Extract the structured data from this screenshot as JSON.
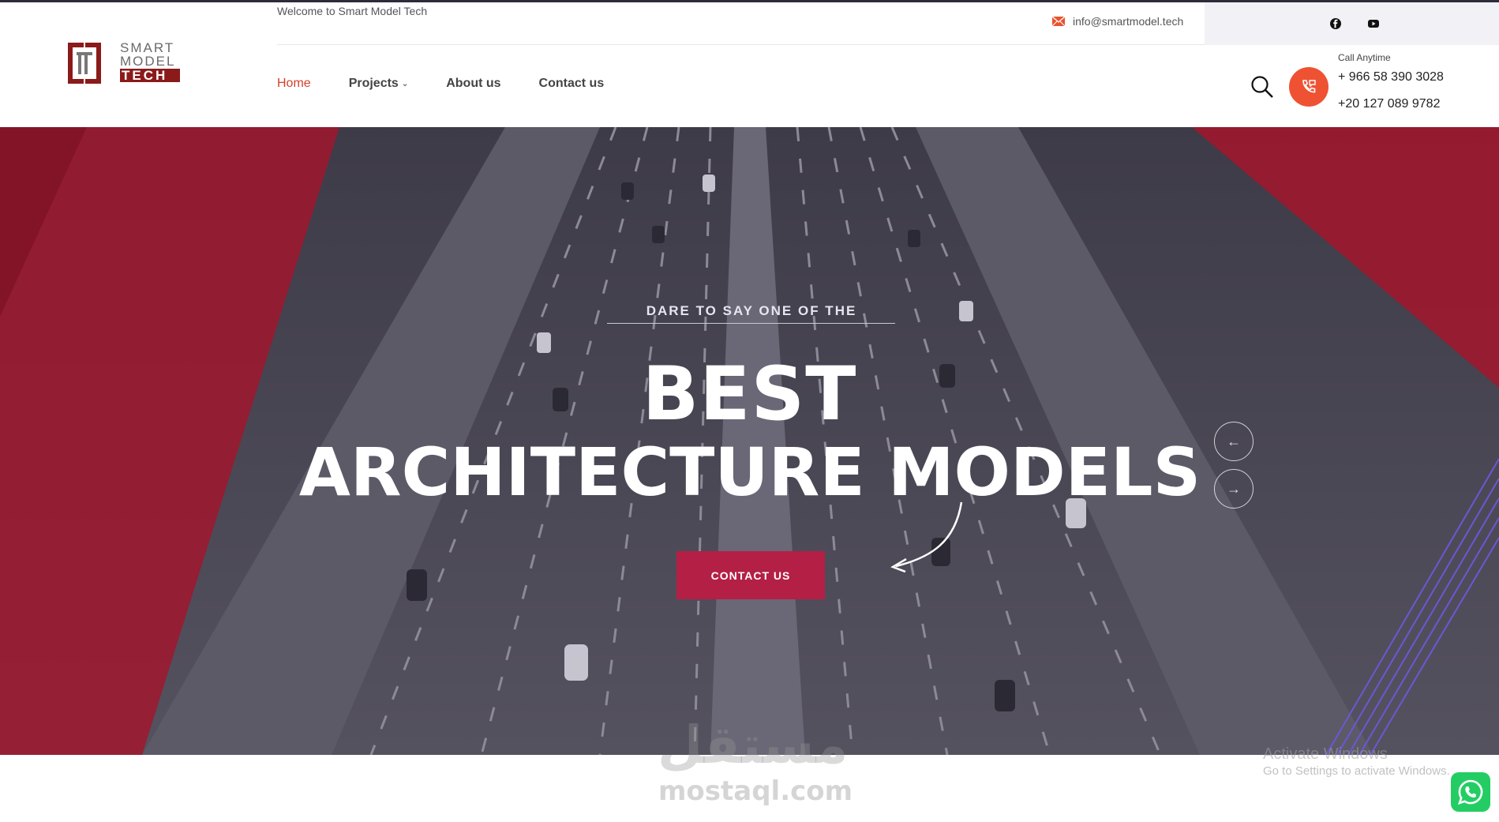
{
  "topbar": {
    "welcome": "Welcome to Smart Model Tech",
    "email": "info@smartmodel.tech",
    "social": [
      "facebook-icon",
      "youtube-icon"
    ]
  },
  "logo": {
    "line1": "SMART",
    "line2": "MODEL",
    "line3": "TECH"
  },
  "nav": {
    "items": [
      {
        "label": "Home",
        "active": true
      },
      {
        "label": "Projects",
        "has_dropdown": true
      },
      {
        "label": "About us"
      },
      {
        "label": "Contact us"
      }
    ]
  },
  "contact": {
    "call_label": "Call Anytime",
    "phone1": "+ 966 58 390 3028",
    "phone2": "+20 127 089 9782"
  },
  "hero": {
    "eyebrow": "DARE TO SAY ONE OF THE",
    "headline_line1": "BEST",
    "headline_line2": "ARCHITECTURE MODELS",
    "cta": "CONTACT US",
    "prev": "←",
    "next": "→"
  },
  "overlay": {
    "watermark_arabic": "مستقل",
    "watermark_site": "mostaql.com",
    "activate_title": "Activate Windows",
    "activate_sub": "Go to Settings to activate Windows."
  },
  "colors": {
    "accent": "#d2412a",
    "phone_button": "#ee5232",
    "cta": "#b41f45",
    "hero_red": "#a3152c",
    "whatsapp": "#24cd63"
  }
}
